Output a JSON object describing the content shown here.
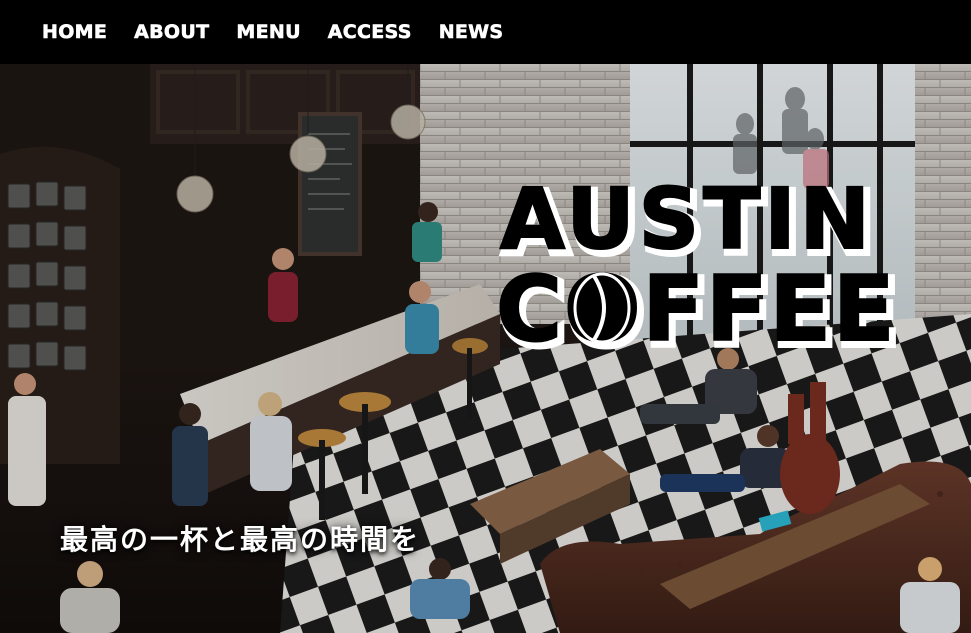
{
  "nav": {
    "items": [
      {
        "label": "HOME"
      },
      {
        "label": "ABOUT"
      },
      {
        "label": "MENU"
      },
      {
        "label": "ACCESS"
      },
      {
        "label": "NEWS"
      }
    ]
  },
  "hero": {
    "logo_line1": "AUSTIN",
    "logo_line2": "COFFEE",
    "tagline": "最高の一杯と最高の時間を"
  },
  "colors": {
    "nav_bg": "#000000",
    "nav_text": "#ffffff",
    "logo_fill": "#000000",
    "logo_outline": "#ffffff"
  }
}
